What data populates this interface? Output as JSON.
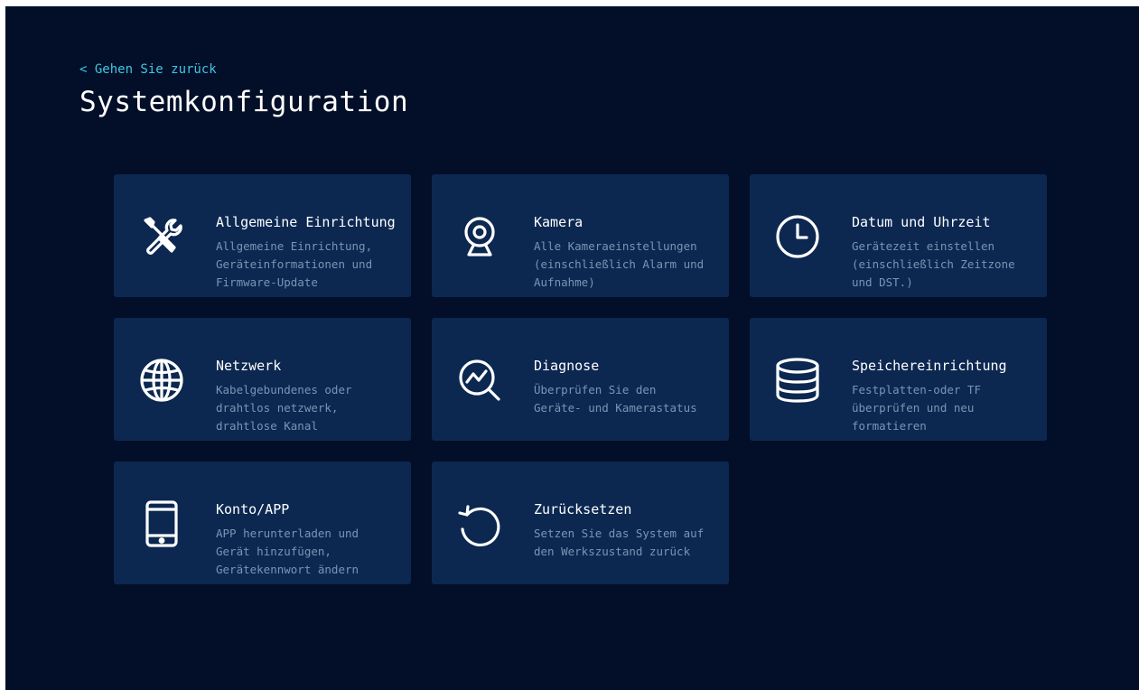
{
  "header": {
    "back_label": "< Gehen Sie zurück",
    "title": "Systemkonfiguration"
  },
  "cards": [
    {
      "title": "Allgemeine Einrichtung",
      "icon": "tools-icon",
      "desc": [
        "Allgemeine Einrichtung,",
        "Geräteinformationen und",
        "Firmware-Update"
      ]
    },
    {
      "title": "Kamera",
      "icon": "webcam-icon",
      "desc": [
        "Alle Kameraeinstellungen",
        "(einschließlich Alarm und",
        "Aufnahme)"
      ]
    },
    {
      "title": "Datum und Uhrzeit",
      "icon": "clock-icon",
      "desc": [
        "Gerätezeit einstellen",
        "(einschließlich Zeitzone",
        "und DST.)"
      ]
    },
    {
      "title": "Netzwerk",
      "icon": "globe-icon",
      "desc": [
        "Kabelgebundenes oder",
        "drahtlos netzwerk,",
        "drahtlose Kanal"
      ]
    },
    {
      "title": "Diagnose",
      "icon": "diagnosis-icon",
      "desc": [
        "Überprüfen Sie den",
        "Geräte- und Kamerastatus"
      ]
    },
    {
      "title": "Speichereinrichtung",
      "icon": "database-icon",
      "desc": [
        "Festplatten-oder TF",
        "überprüfen und neu",
        "formatieren"
      ]
    },
    {
      "title": "Konto/APP",
      "icon": "phone-icon",
      "desc": [
        "APP herunterladen und",
        "Gerät hinzufügen,",
        "Gerätekennwort ändern"
      ]
    },
    {
      "title": "Zurücksetzen",
      "icon": "reset-icon",
      "desc": [
        "Setzen Sie das System auf",
        "den Werkszustand zurück"
      ]
    }
  ],
  "colors": {
    "background": "#030f28",
    "card": "#0c2851",
    "accent": "#3fc7e6",
    "title_text": "#ffffff",
    "desc_text": "#7d93b3"
  }
}
